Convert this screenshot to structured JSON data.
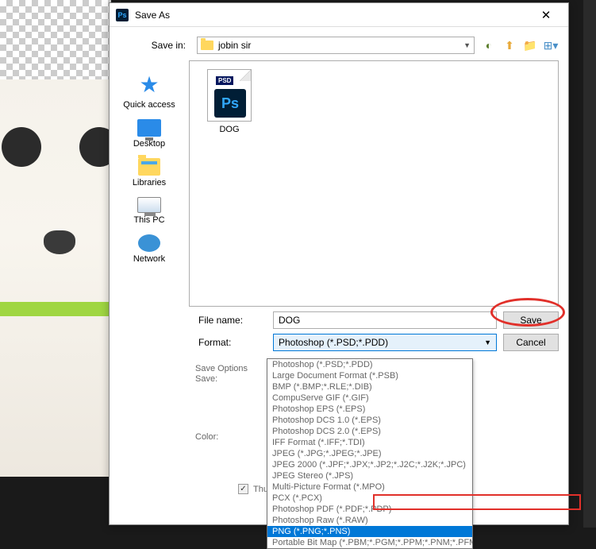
{
  "dialog": {
    "title": "Save As",
    "save_in_label": "Save in:",
    "save_in_value": "jobin sir",
    "file_name_label": "File name:",
    "file_name_value": "DOG",
    "format_label": "Format:",
    "format_value": "Photoshop (*.PSD;*.PDD)",
    "save_btn": "Save",
    "cancel_btn": "Cancel"
  },
  "left_nav": [
    {
      "label": "Quick access"
    },
    {
      "label": "Desktop"
    },
    {
      "label": "Libraries"
    },
    {
      "label": "This PC"
    },
    {
      "label": "Network"
    }
  ],
  "file": {
    "name": "DOG",
    "badge": "PSD"
  },
  "format_options": [
    "Photoshop (*.PSD;*.PDD)",
    "Large Document Format (*.PSB)",
    "BMP (*.BMP;*.RLE;*.DIB)",
    "CompuServe GIF (*.GIF)",
    "Photoshop EPS (*.EPS)",
    "Photoshop DCS 1.0 (*.EPS)",
    "Photoshop DCS 2.0 (*.EPS)",
    "IFF Format (*.IFF;*.TDI)",
    "JPEG (*.JPG;*.JPEG;*.JPE)",
    "JPEG 2000 (*.JPF;*.JPX;*.JP2;*.J2C;*.J2K;*.JPC)",
    "JPEG Stereo (*.JPS)",
    "Multi-Picture Format (*.MPO)",
    "PCX (*.PCX)",
    "Photoshop PDF (*.PDF;*.PDP)",
    "Photoshop Raw (*.RAW)",
    "PNG (*.PNG;*.PNS)",
    "Portable Bit Map (*.PBM;*.PGM;*.PPM;*.PNM;*.PFM;*.PAM)"
  ],
  "selected_format_index": 15,
  "save_options": {
    "header": "Save Options",
    "save_label": "Save:",
    "color_label": "Color:",
    "thumbnail": "Thumbnail"
  }
}
